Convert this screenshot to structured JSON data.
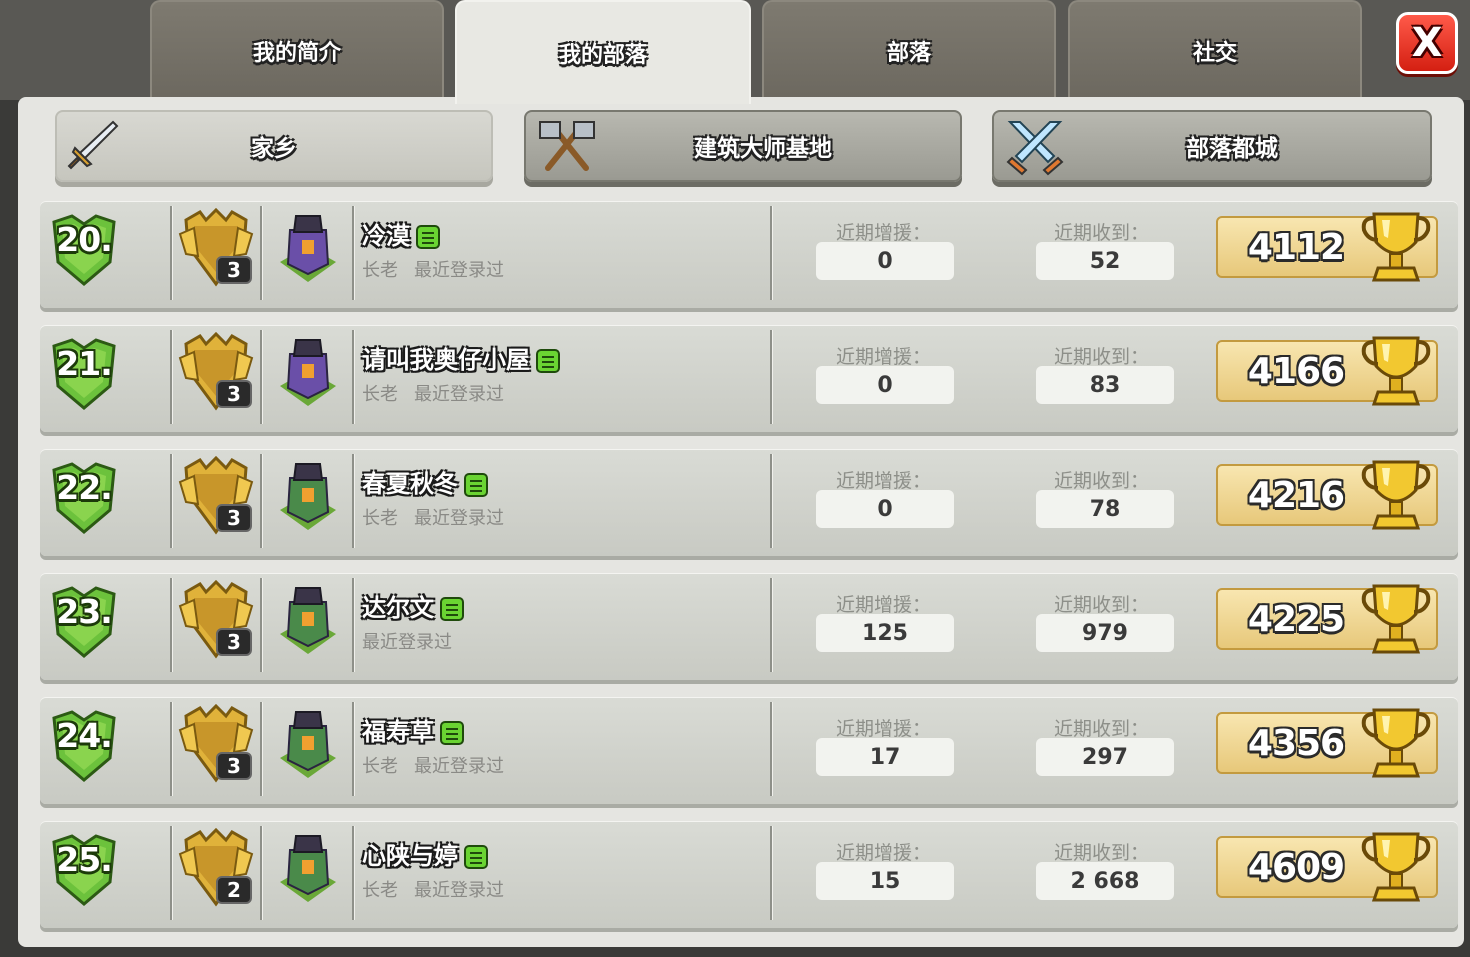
{
  "tabs": [
    {
      "label": "我的简介",
      "active": false
    },
    {
      "label": "我的部落",
      "active": true
    },
    {
      "label": "部落",
      "active": false
    },
    {
      "label": "社交",
      "active": false
    }
  ],
  "close_label": "X",
  "subtabs": [
    {
      "label": "家乡",
      "icon": "sword-icon",
      "active": true
    },
    {
      "label": "建筑大师基地",
      "icon": "crossed-axes-icon",
      "active": false
    },
    {
      "label": "部落都城",
      "icon": "crossed-swords-icon",
      "active": false
    }
  ],
  "stat_labels": {
    "donated": "近期增援：",
    "received": "近期收到："
  },
  "members": [
    {
      "rank": "20.",
      "league_level": "3",
      "name": "冷漠",
      "role": "长老",
      "status": "最近登录过",
      "donated": "0",
      "received": "52",
      "trophies": "4112",
      "th_color": "#6a4fa8"
    },
    {
      "rank": "21.",
      "league_level": "3",
      "name": "请叫我奥仔小屋",
      "role": "长老",
      "status": "最近登录过",
      "donated": "0",
      "received": "83",
      "trophies": "4166",
      "th_color": "#6a4fa8"
    },
    {
      "rank": "22.",
      "league_level": "3",
      "name": "春夏秋冬",
      "role": "长老",
      "status": "最近登录过",
      "donated": "0",
      "received": "78",
      "trophies": "4216",
      "th_color": "#4a8a4a"
    },
    {
      "rank": "23.",
      "league_level": "3",
      "name": "达尔文",
      "role": "",
      "status": "最近登录过",
      "donated": "125",
      "received": "979",
      "trophies": "4225",
      "th_color": "#4a8a4a"
    },
    {
      "rank": "24.",
      "league_level": "3",
      "name": "福寿草",
      "role": "长老",
      "status": "最近登录过",
      "donated": "17",
      "received": "297",
      "trophies": "4356",
      "th_color": "#4a8a4a"
    },
    {
      "rank": "25.",
      "league_level": "2",
      "name": "心陕与婷",
      "role": "长老",
      "status": "最近登录过",
      "donated": "15",
      "received": "2 668",
      "trophies": "4609",
      "th_color": "#4a8a4a"
    }
  ]
}
